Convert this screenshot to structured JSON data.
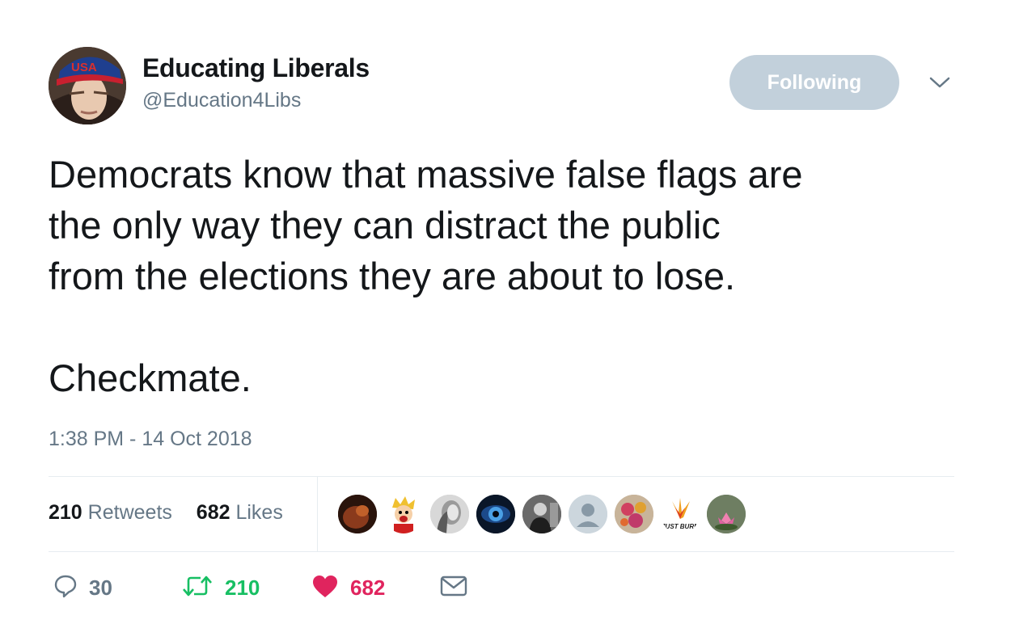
{
  "user": {
    "name": "Educating Liberals",
    "handle": "@Education4Libs",
    "avatar_cap_text": "USA"
  },
  "follow_button": {
    "label": "Following"
  },
  "tweet": {
    "lines": [
      "Democrats know that massive false flags are",
      "the only way they can distract the public",
      "from the elections they are about to lose.",
      "",
      "Checkmate."
    ],
    "timestamp": "1:38 PM - 14 Oct 2018"
  },
  "stats": {
    "retweets_count": "210",
    "retweets_label": "Retweets",
    "likes_count": "682",
    "likes_label": "Likes"
  },
  "likers": [
    {
      "name": "liker-avatar-1"
    },
    {
      "name": "liker-avatar-2"
    },
    {
      "name": "liker-avatar-3"
    },
    {
      "name": "liker-avatar-4"
    },
    {
      "name": "liker-avatar-5"
    },
    {
      "name": "liker-avatar-6"
    },
    {
      "name": "liker-avatar-7"
    },
    {
      "name": "liker-avatar-8",
      "text": "JUST BURN"
    },
    {
      "name": "liker-avatar-9"
    }
  ],
  "actions": {
    "reply_count": "30",
    "retweet_count": "210",
    "like_count": "682"
  },
  "colors": {
    "retweet_green": "#17bf63",
    "like_red": "#e0245e",
    "follow_button_bg": "#c2d0db",
    "secondary_text": "#657786"
  },
  "icons": [
    "reply-icon",
    "retweet-icon",
    "heart-icon",
    "direct-message-icon",
    "chevron-down-icon"
  ]
}
